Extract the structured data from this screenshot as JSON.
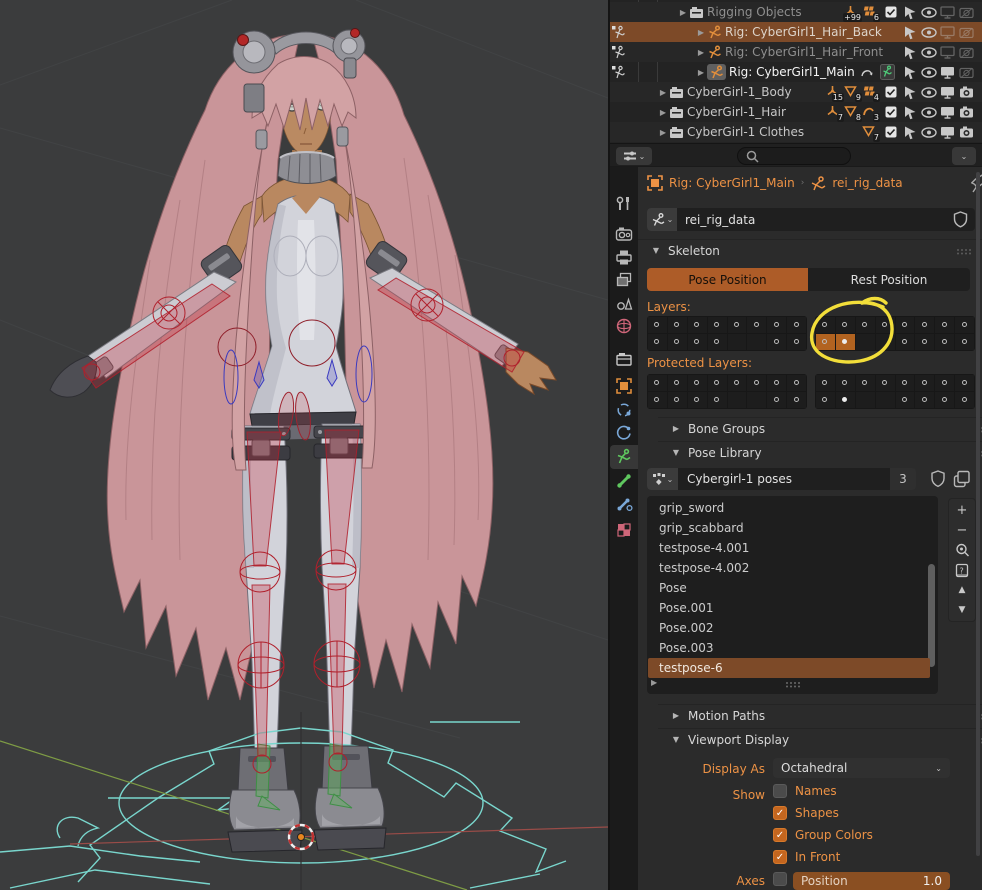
{
  "colors": {
    "accent_orange": "#ed9245",
    "selection_bg": "#7d4a28",
    "checkbox_on": "#c4661f",
    "active_toggle": "#ad5c28",
    "teal_widget": "#79d6cd",
    "annotation_yellow": "#f2de3a",
    "viewport_bg": "#3b3c3d",
    "panel_bg": "#2b2b2b",
    "outliner_bg": "#232323"
  },
  "icons": {
    "search": "magnifier-icon",
    "filter": "chevron-down-icon",
    "pin": "pushpin-icon",
    "fake_user": "shield-icon",
    "new_copy": "copy-icon",
    "unlink": "x-icon",
    "add": "plus-icon",
    "remove": "minus-icon",
    "apply_pose": "magnifier-icon",
    "sanitize": "book-question-icon",
    "move_up": "triangle-up-icon",
    "move_down": "triangle-down-icon"
  },
  "outliner": {
    "rows": [
      {
        "label": "Rigging Objects",
        "kind": "collection",
        "level": 2,
        "tone": "dim",
        "selected": false,
        "gutter": false,
        "badges": [
          {
            "icon": "armature-count",
            "value": "+99"
          },
          {
            "icon": "brick-count",
            "value": "6"
          }
        ],
        "checkbox": true,
        "monitor_on": false,
        "camera_on": false,
        "extras": []
      },
      {
        "label": "Rig: CyberGirl1_Hair_Back",
        "kind": "armature",
        "level": 3,
        "tone": "sel",
        "selected": true,
        "gutter": true,
        "badges": [],
        "checkbox": false,
        "monitor_on": false,
        "camera_on": false,
        "extras": []
      },
      {
        "label": "Rig: CyberGirl1_Hair_Front",
        "kind": "armature",
        "level": 3,
        "tone": "dim",
        "selected": false,
        "gutter": true,
        "badges": [],
        "checkbox": false,
        "monitor_on": false,
        "camera_on": false,
        "extras": []
      },
      {
        "label": "Rig: CyberGirl1_Main",
        "kind": "armature-active",
        "level": 3,
        "tone": "active",
        "selected": false,
        "gutter": true,
        "badges": [],
        "checkbox": false,
        "monitor_on": true,
        "camera_on": false,
        "extras": [
          "constraint-icon",
          "pose-mode-icon"
        ]
      },
      {
        "label": "CyberGirl-1_Body",
        "kind": "collection",
        "level": 1,
        "tone": "normal",
        "selected": false,
        "gutter": false,
        "badges": [
          {
            "icon": "armature-count",
            "value": "15"
          },
          {
            "icon": "mesh-count",
            "value": "9"
          },
          {
            "icon": "brick-count",
            "value": "4"
          }
        ],
        "checkbox": true,
        "monitor_on": true,
        "camera_on": true,
        "extras": []
      },
      {
        "label": "CyberGirl-1_Hair",
        "kind": "collection",
        "level": 1,
        "tone": "normal",
        "selected": false,
        "gutter": false,
        "badges": [
          {
            "icon": "armature-count",
            "value": "7"
          },
          {
            "icon": "mesh-count",
            "value": "8"
          },
          {
            "icon": "curve-count",
            "value": "3"
          }
        ],
        "checkbox": true,
        "monitor_on": true,
        "camera_on": true,
        "extras": []
      },
      {
        "label": "CyberGirl-1 Clothes",
        "kind": "collection",
        "level": 1,
        "tone": "normal",
        "selected": false,
        "gutter": false,
        "badges": [
          {
            "icon": "mesh-count",
            "value": "7"
          }
        ],
        "checkbox": true,
        "monitor_on": true,
        "camera_on": true,
        "extras": []
      }
    ]
  },
  "header": {
    "search_placeholder": ""
  },
  "tabs": {
    "active_id": "object-data",
    "items": [
      {
        "id": "tool"
      },
      {
        "id": "render"
      },
      {
        "id": "output"
      },
      {
        "id": "view-layer"
      },
      {
        "id": "scene"
      },
      {
        "id": "world"
      },
      {
        "id": "collection"
      },
      {
        "id": "object"
      },
      {
        "id": "physics"
      },
      {
        "id": "constraints"
      },
      {
        "id": "object-data"
      },
      {
        "id": "bone"
      },
      {
        "id": "bone-constraints"
      },
      {
        "id": "texture"
      }
    ]
  },
  "breadcrumb": {
    "object_label": "Rig: CyberGirl1_Main",
    "data_label": "rei_rig_data"
  },
  "name_field": {
    "value": "rei_rig_data"
  },
  "skeleton": {
    "title": "Skeleton",
    "pose_button": "Pose Position",
    "rest_button": "Rest Position",
    "layers_label": "Layers:",
    "protected_label": "Protected Layers:",
    "layers": {
      "left": [
        [
          1,
          1,
          1,
          1,
          1,
          1,
          1,
          1
        ],
        [
          1,
          1,
          1,
          1,
          0,
          0,
          1,
          1
        ]
      ],
      "right": [
        [
          1,
          1,
          1,
          1,
          1,
          1,
          1,
          1
        ],
        [
          3,
          4,
          0,
          0,
          1,
          1,
          1,
          1
        ]
      ]
    },
    "protected": {
      "left": [
        [
          1,
          1,
          1,
          1,
          1,
          1,
          1,
          1
        ],
        [
          1,
          1,
          1,
          1,
          0,
          0,
          1,
          1
        ]
      ],
      "right": [
        [
          1,
          1,
          1,
          1,
          1,
          1,
          1,
          1
        ],
        [
          1,
          2,
          0,
          0,
          1,
          1,
          1,
          1
        ]
      ]
    },
    "annotation": {
      "type": "hand-drawn-highlight-circle",
      "color": "#f2de3a",
      "target": "enabled layer toggles"
    }
  },
  "bone_groups": {
    "title": "Bone Groups"
  },
  "pose_library": {
    "title": "Pose Library",
    "datablock_name": "Cybergirl-1 poses",
    "users": "3",
    "items": [
      "grip_sword",
      "grip_scabbard",
      "testpose-4.001",
      "testpose-4.002",
      "Pose",
      "Pose.001",
      "Pose.002",
      "Pose.003",
      "testpose-6"
    ],
    "selected_index": 8
  },
  "motion_paths": {
    "title": "Motion Paths"
  },
  "viewport_display": {
    "title": "Viewport Display",
    "display_as_label": "Display As",
    "display_as_value": "Octahedral",
    "show_label": "Show",
    "options": [
      {
        "label": "Names",
        "checked": false
      },
      {
        "label": "Shapes",
        "checked": true
      },
      {
        "label": "Group Colors",
        "checked": true
      },
      {
        "label": "In Front",
        "checked": true
      }
    ],
    "axes_label": "Axes",
    "axes_checked": false,
    "position_label": "Position",
    "position_value": "1.0"
  }
}
